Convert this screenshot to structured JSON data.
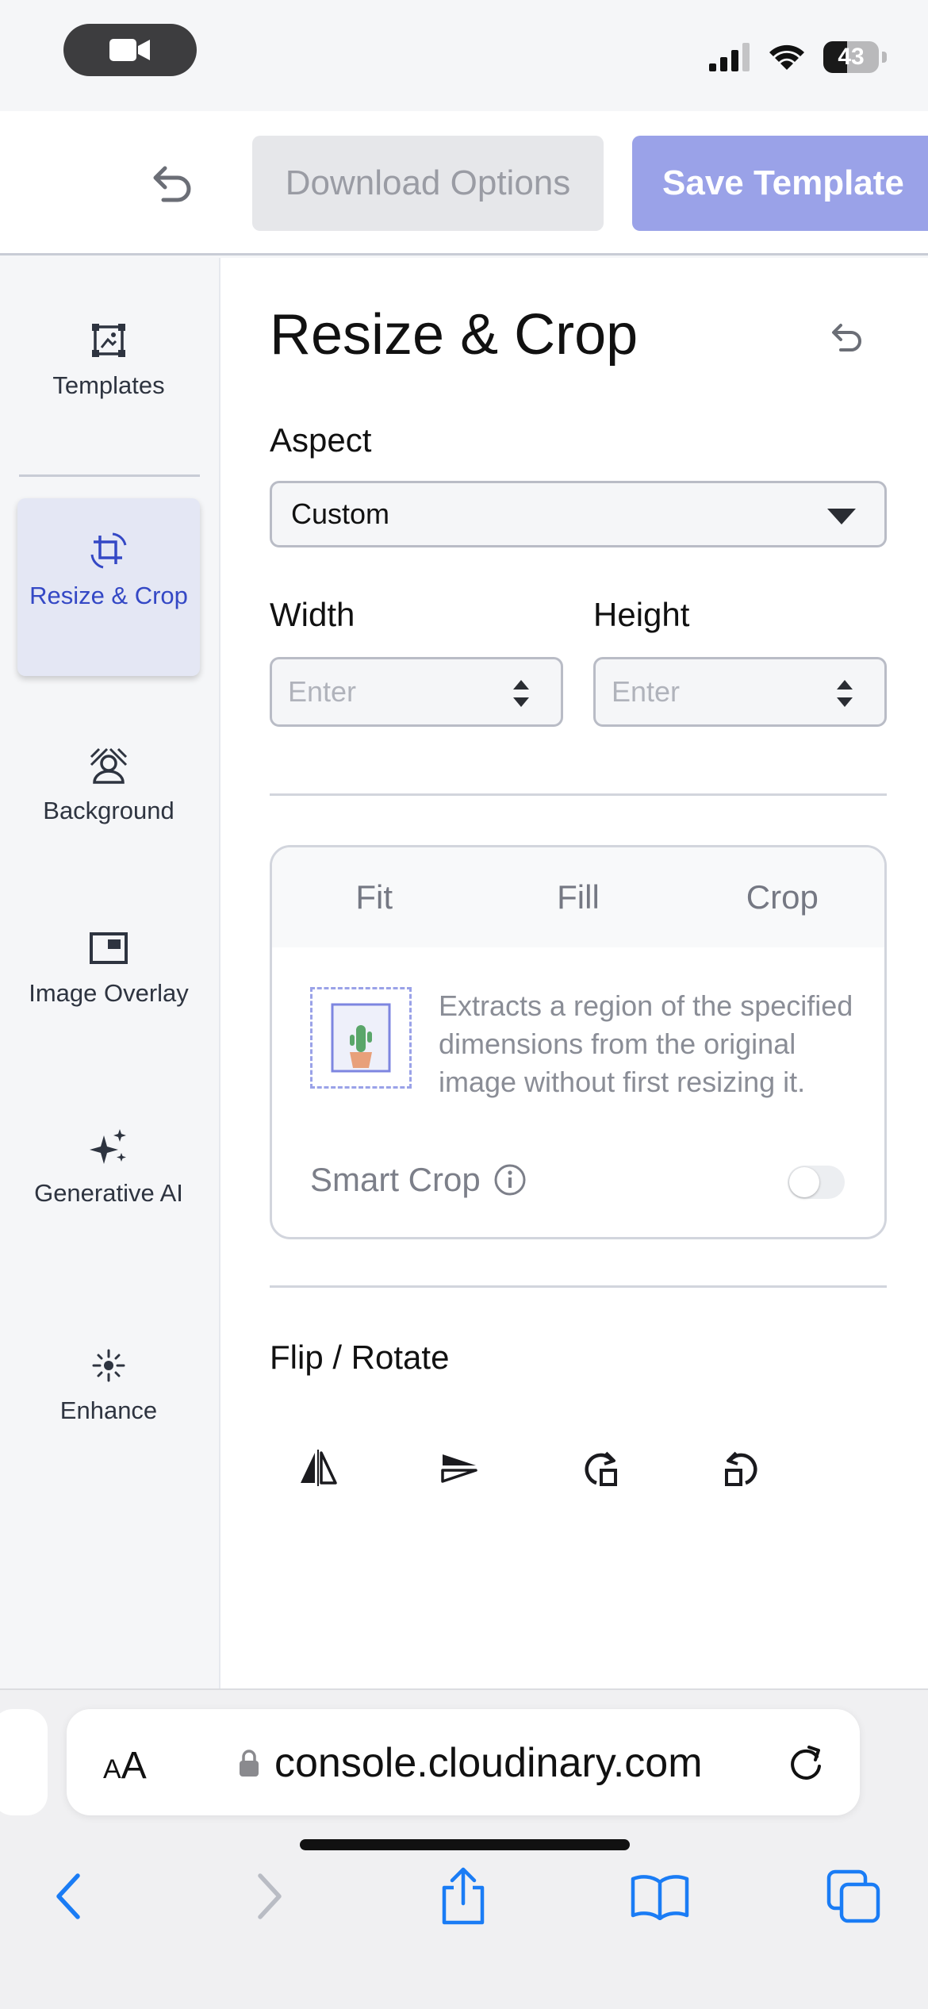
{
  "status_bar": {
    "battery": "43",
    "battery_level": 0.43
  },
  "toolbar": {
    "download_label": "Download Options",
    "save_label": "Save Template"
  },
  "sidebar": {
    "items": [
      {
        "label": "Templates",
        "icon": "templates-icon"
      },
      {
        "label": "Resize & Crop",
        "icon": "crop-rotate-icon",
        "active": true
      },
      {
        "label": "Background",
        "icon": "background-person-icon"
      },
      {
        "label": "Image Overlay",
        "icon": "image-overlay-icon"
      },
      {
        "label": "Generative AI",
        "icon": "sparkles-icon"
      },
      {
        "label": "Enhance",
        "icon": "enhance-icon"
      }
    ]
  },
  "panel": {
    "title": "Resize & Crop",
    "aspect_label": "Aspect",
    "aspect_value": "Custom",
    "width_label": "Width",
    "height_label": "Height",
    "width_placeholder": "Enter",
    "height_placeholder": "Enter",
    "modes": [
      "Fit",
      "Fill",
      "Crop"
    ],
    "mode_description": "Extracts a region of the specified dimensions from the original image without first resizing it.",
    "smart_crop_label": "Smart Crop",
    "smart_crop_on": false,
    "flip_rotate_label": "Flip / Rotate"
  },
  "browser": {
    "text_size_label": "AA",
    "url": "console.cloudinary.com"
  },
  "colors": {
    "accent": "#3448c5",
    "save_button": "#9aa2e8",
    "safari_blue": "#1a7cf5"
  }
}
